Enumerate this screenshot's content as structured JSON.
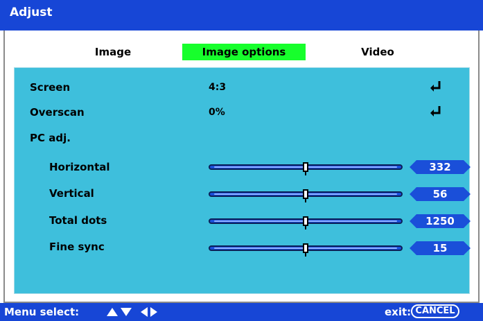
{
  "title": "Adjust",
  "tabs": [
    {
      "label": "Image"
    },
    {
      "label": "Image options"
    },
    {
      "label": "Video"
    }
  ],
  "rows": {
    "screen": {
      "label": "Screen",
      "value": "4:3"
    },
    "overscan": {
      "label": "Overscan",
      "value": "0%"
    },
    "pc_adj": {
      "label": "PC adj."
    }
  },
  "sliders": [
    {
      "label": "Horizontal",
      "value": "332",
      "level": 0.5
    },
    {
      "label": "Vertical",
      "value": "56",
      "level": 0.5
    },
    {
      "label": "Total dots",
      "value": "1250",
      "level": 0.5
    },
    {
      "label": "Fine sync",
      "value": "15",
      "level": 0.5
    }
  ],
  "footer": {
    "menu_select": "Menu select:",
    "exit": "exit:",
    "cancel_key": "CANCEL"
  },
  "colors": {
    "titlebar": "#1746d6",
    "selected_tab": "#17ff2c",
    "panel": "#3ebfdc",
    "slider": "#1a4fd9"
  }
}
